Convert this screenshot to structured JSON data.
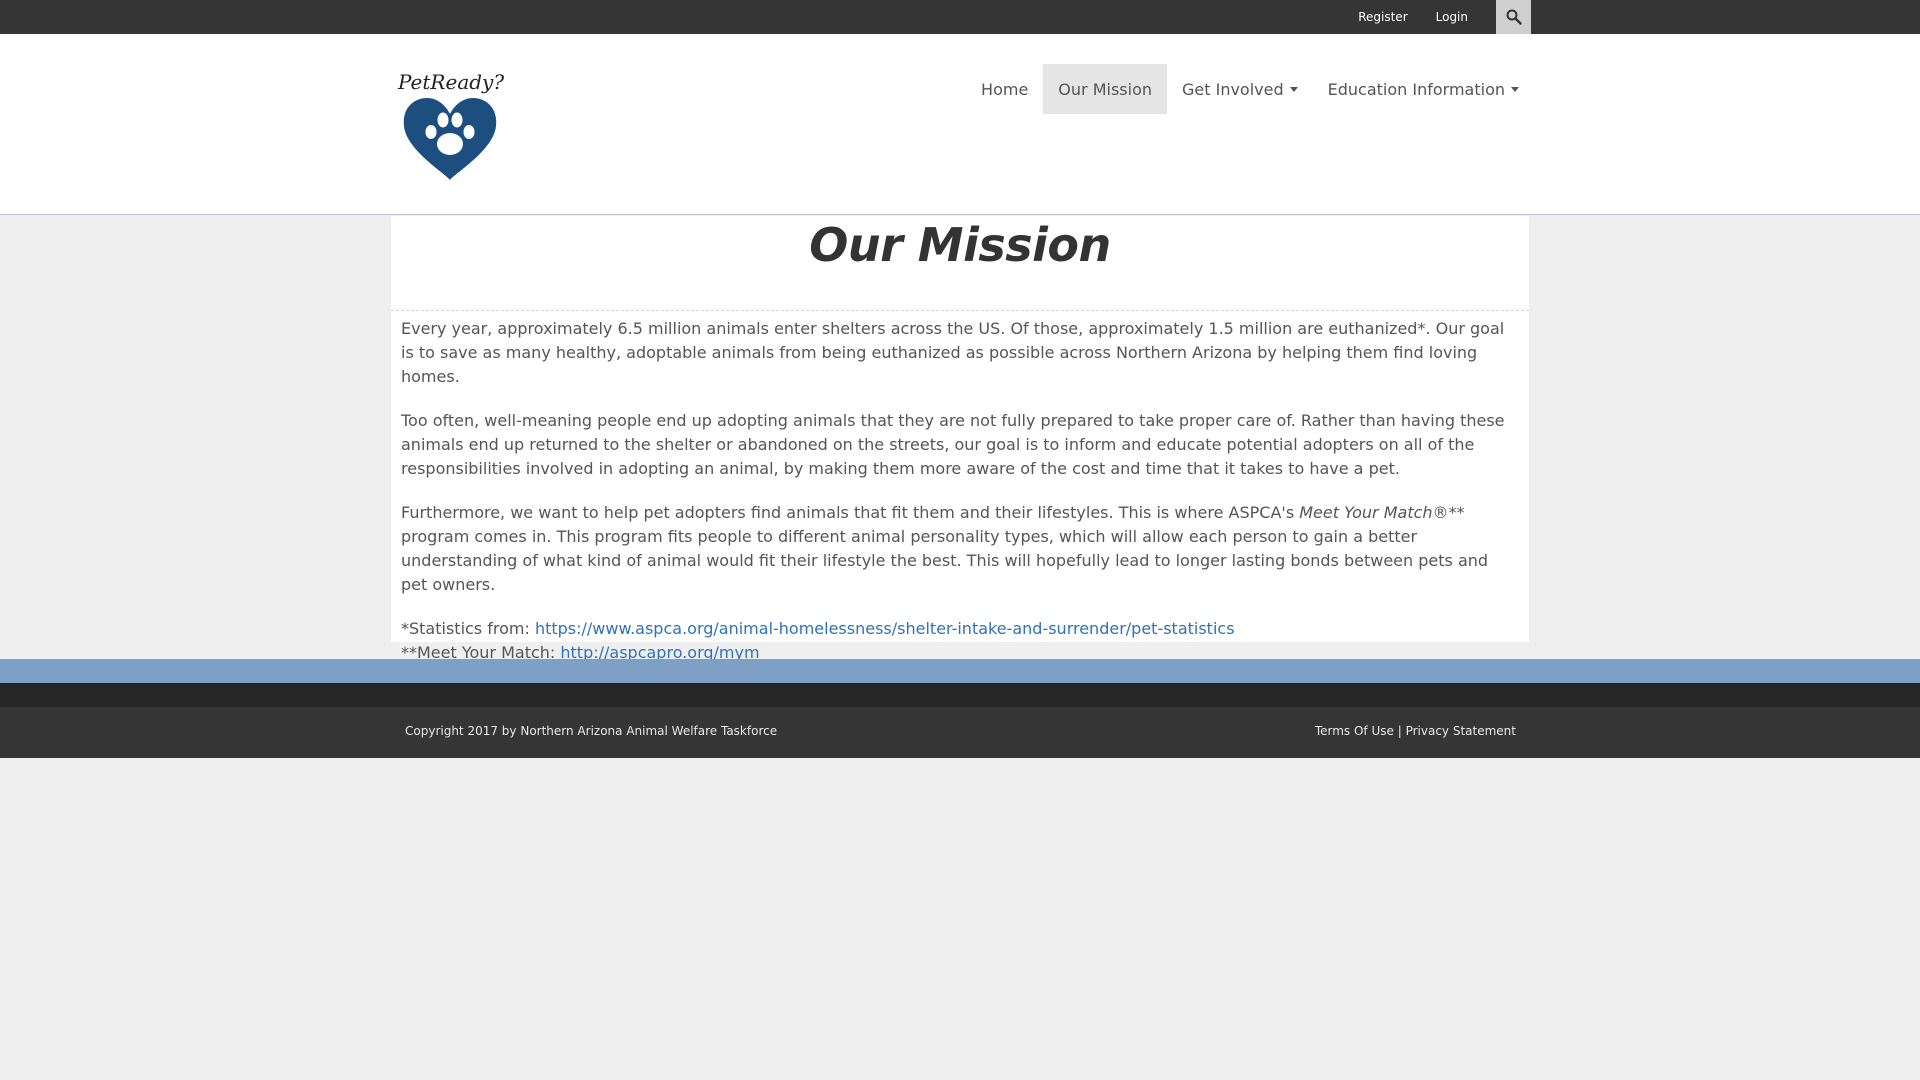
{
  "topbar": {
    "register_label": "Register",
    "login_label": "Login",
    "search_icon": "search-icon"
  },
  "logo": {
    "text": "PetReady?",
    "icon": "heart-paw-icon",
    "heart_color": "#1c4e80"
  },
  "nav": {
    "items": [
      {
        "label": "Home",
        "active": false
      },
      {
        "label": "Our Mission",
        "active": true
      },
      {
        "label": "Get Involved",
        "active": false,
        "dropdown": true
      },
      {
        "label": "Education Information",
        "active": false,
        "dropdown": true
      }
    ]
  },
  "main": {
    "title": "Our Mission",
    "p1": "Every year, approximately 6.5 million animals enter shelters across the US. Of those, approximately 1.5 million are euthanized*. Our goal is to save as many healthy, adoptable animals from being euthanized as possible across Northern Arizona by helping them find loving homes.",
    "p2": "Too often, well-meaning people end up adopting animals that they are not fully prepared to take proper care of. Rather than having these animals end up returned to the shelter or abandoned on the streets, our goal is to inform and educate potential adopters on all of the responsibilities involved in adopting an animal, by making them more aware of the cost and time that it takes to have a pet.",
    "p3_before": "Furthermore, we want to help pet adopters find animals that fit them and their lifestyles. This is where ASPCA's ",
    "p3_italic": "Meet Your Match®",
    "p3_after": "** program comes in. This program fits people to different animal personality types, which will allow each person to gain a better understanding of what kind of animal would fit their lifestyle the best. This will hopefully lead to longer lasting bonds between pets and pet owners.",
    "stats_label": "*Statistics from: ",
    "stats_link": "https://www.aspca.org/animal-homelessness/shelter-intake-and-surrender/pet-statistics",
    "mym_label": "**Meet Your Match: ",
    "mym_link": "http://aspcapro.org/mym"
  },
  "footer": {
    "copyright": "Copyright 2017 by Northern Arizona Animal Welfare Taskforce",
    "terms_label": "Terms Of Use",
    "separator": "|",
    "privacy_label": "Privacy Statement",
    "stripe_color": "#7da0c4"
  }
}
